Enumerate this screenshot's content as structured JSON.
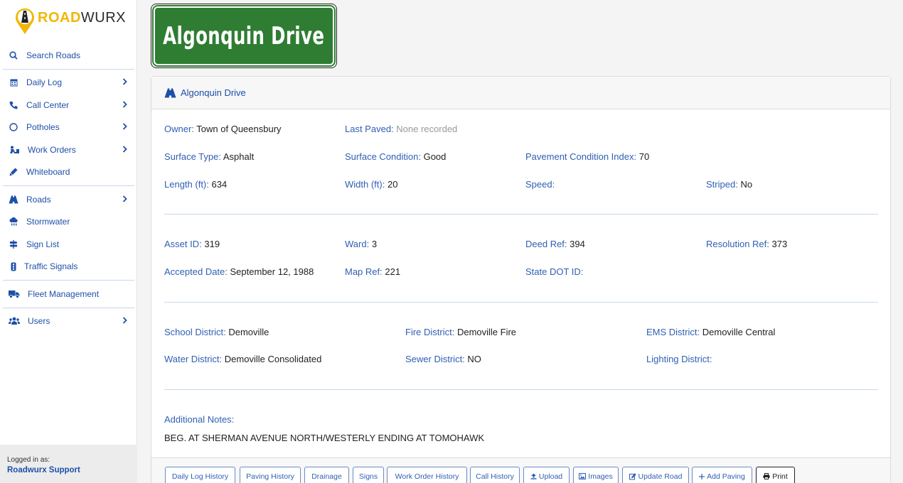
{
  "brand": {
    "road": "ROAD",
    "wurx": "WURX"
  },
  "sidebar": {
    "items": [
      {
        "label": "Search Roads",
        "icon": "search-icon",
        "chevron": false
      },
      {
        "label": "Daily Log",
        "icon": "calendar-icon",
        "chevron": true
      },
      {
        "label": "Call Center",
        "icon": "phone-icon",
        "chevron": true
      },
      {
        "label": "Potholes",
        "icon": "circle-icon",
        "chevron": true
      },
      {
        "label": "Work Orders",
        "icon": "worker-icon",
        "chevron": true
      },
      {
        "label": "Whiteboard",
        "icon": "marker-icon",
        "chevron": false
      },
      {
        "label": "Roads",
        "icon": "road-icon",
        "chevron": true
      },
      {
        "label": "Stormwater",
        "icon": "cloud-rain-icon",
        "chevron": false
      },
      {
        "label": "Sign List",
        "icon": "signs-icon",
        "chevron": false
      },
      {
        "label": "Traffic Signals",
        "icon": "traffic-light-icon",
        "chevron": false
      },
      {
        "label": "Fleet Management",
        "icon": "truck-icon",
        "chevron": false
      },
      {
        "label": "Users",
        "icon": "users-icon",
        "chevron": true
      }
    ],
    "logged_in_label": "Logged in as:",
    "user": "Roadwurx Support"
  },
  "sign": {
    "text": "Algonquin Drive"
  },
  "card": {
    "title": "Algonquin Drive",
    "owner": {
      "k": "Owner:",
      "v": "Town of Queensbury"
    },
    "last_paved": {
      "k": "Last Paved:",
      "v": "None recorded"
    },
    "surface_type": {
      "k": "Surface Type:",
      "v": "Asphalt"
    },
    "surface_condition": {
      "k": "Surface Condition:",
      "v": "Good"
    },
    "pci": {
      "k": "Pavement Condition Index:",
      "v": "70"
    },
    "length": {
      "k": "Length (ft):",
      "v": "634"
    },
    "width": {
      "k": "Width (ft):",
      "v": "20"
    },
    "speed": {
      "k": "Speed:",
      "v": ""
    },
    "striped": {
      "k": "Striped:",
      "v": "No"
    },
    "asset_id": {
      "k": "Asset ID:",
      "v": "319"
    },
    "ward": {
      "k": "Ward:",
      "v": "3"
    },
    "deed_ref": {
      "k": "Deed Ref:",
      "v": "394"
    },
    "resolution_ref": {
      "k": "Resolution Ref:",
      "v": "373"
    },
    "accepted_date": {
      "k": "Accepted Date:",
      "v": "September 12, 1988"
    },
    "map_ref": {
      "k": "Map Ref:",
      "v": "221"
    },
    "state_dot_id": {
      "k": "State DOT ID:",
      "v": ""
    },
    "school_district": {
      "k": "School District:",
      "v": "Demoville"
    },
    "fire_district": {
      "k": "Fire District:",
      "v": "Demoville Fire"
    },
    "ems_district": {
      "k": "EMS District:",
      "v": "Demoville Central"
    },
    "water_district": {
      "k": "Water District:",
      "v": "Demoville Consolidated"
    },
    "sewer_district": {
      "k": "Sewer District:",
      "v": "NO"
    },
    "lighting_district": {
      "k": "Lighting District:",
      "v": ""
    },
    "notes_label": "Additional Notes:",
    "notes": "BEG. AT SHERMAN AVENUE NORTH/WESTERLY ENDING AT TOMOHAWK"
  },
  "buttons": {
    "daily_log_history": "Daily Log History",
    "paving_history": "Paving History",
    "drainage": "Drainage",
    "signs": "Signs",
    "work_order_history": "Work Order History",
    "call_history": "Call History",
    "upload": "Upload",
    "images": "Images",
    "update_road": "Update Road",
    "add_paving": "Add Paving",
    "print": "Print"
  },
  "colors": {
    "accent": "#1e4fa8",
    "sign_green": "#2e7d32",
    "brand_yellow": "#f2b705"
  }
}
